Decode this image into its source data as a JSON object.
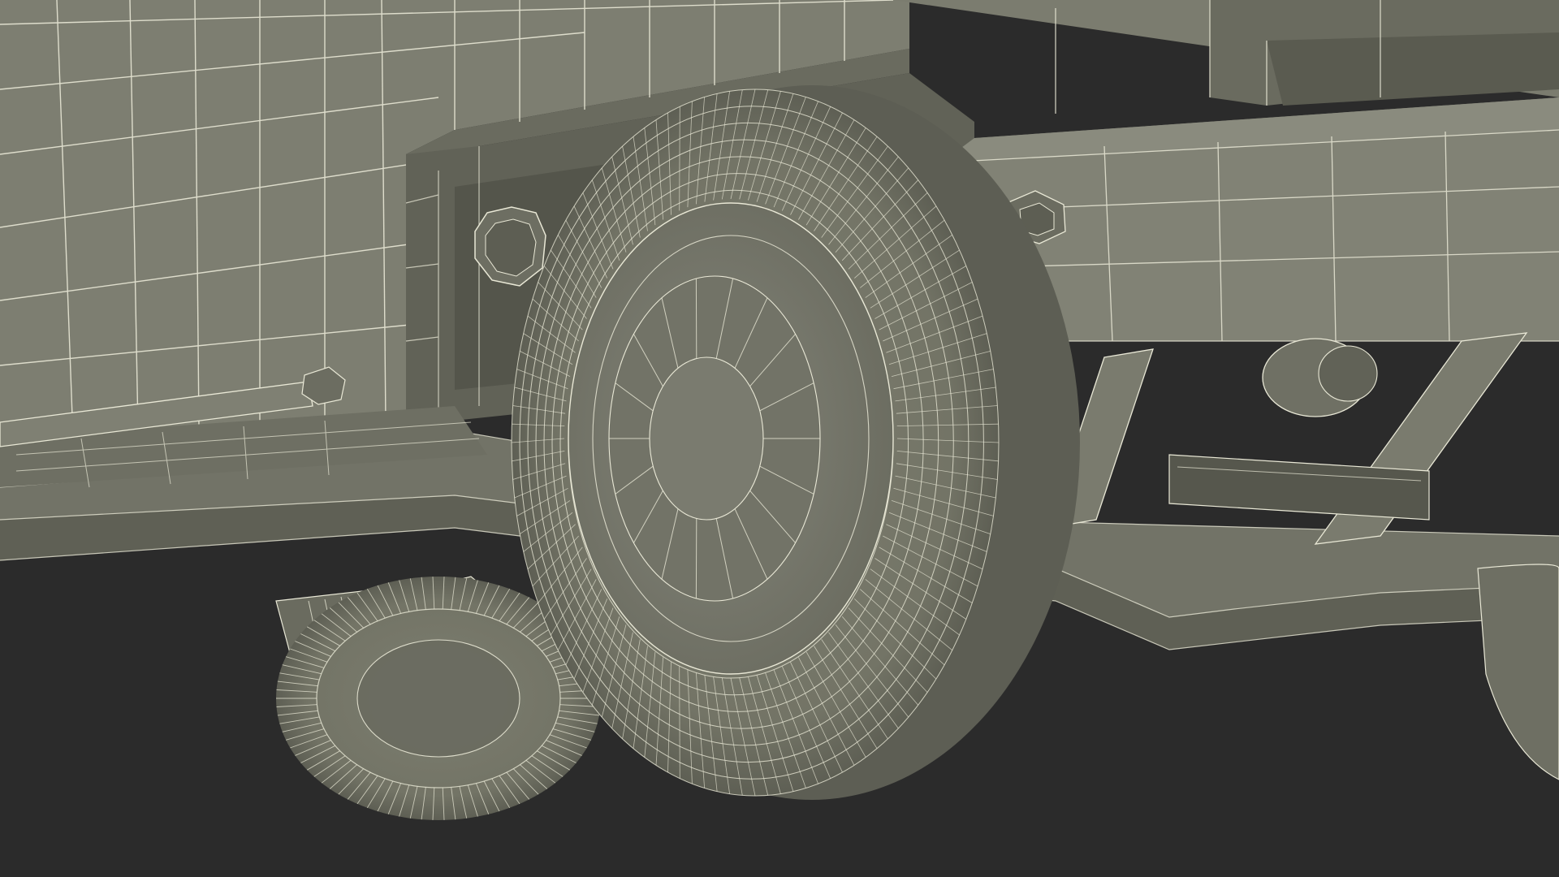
{
  "scene": {
    "subject": "wireframe-vehicle-undercarriage",
    "colors": {
      "background": "#2b2b2b",
      "surface": "#7a7b6d",
      "surface_dark": "#5c5d52",
      "surface_shadow": "#4a4b42",
      "wire": "#e9e8d6"
    }
  }
}
